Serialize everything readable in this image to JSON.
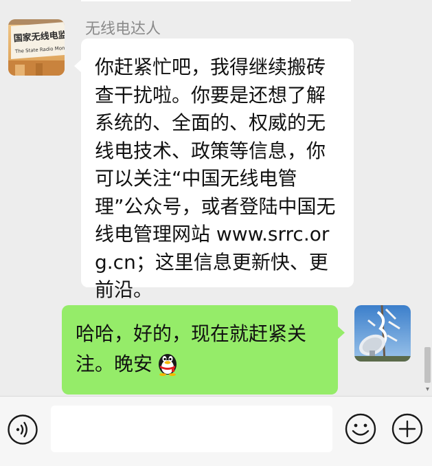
{
  "chat": {
    "incoming": {
      "sender": "无线电达人",
      "text": "你赶紧忙吧，我得继续搬砖查干扰啦。你要是还想了解系统的、全面的、权威的无线电技术、政策等信息，你可以关注“中国无线电管理”公众号，或者登陆中国无线电管理网站 www.srrc.org.cn；这里信息更新快、更前沿。",
      "avatar_sign_text": "国家无线电监 The State Radio Moni"
    },
    "outgoing": {
      "text": "哈哈，好的，现在就赶紧关注。晚安",
      "emoji": "qq-penguin-emoji"
    }
  },
  "input_bar": {
    "placeholder": "",
    "voice_icon": "voice-icon",
    "emoji_icon": "smiley-icon",
    "more_icon": "plus-circle-icon"
  },
  "colors": {
    "background": "#ededed",
    "incoming_bubble": "#ffffff",
    "outgoing_bubble": "#95ec69",
    "sender_name": "#8a8a8a"
  }
}
